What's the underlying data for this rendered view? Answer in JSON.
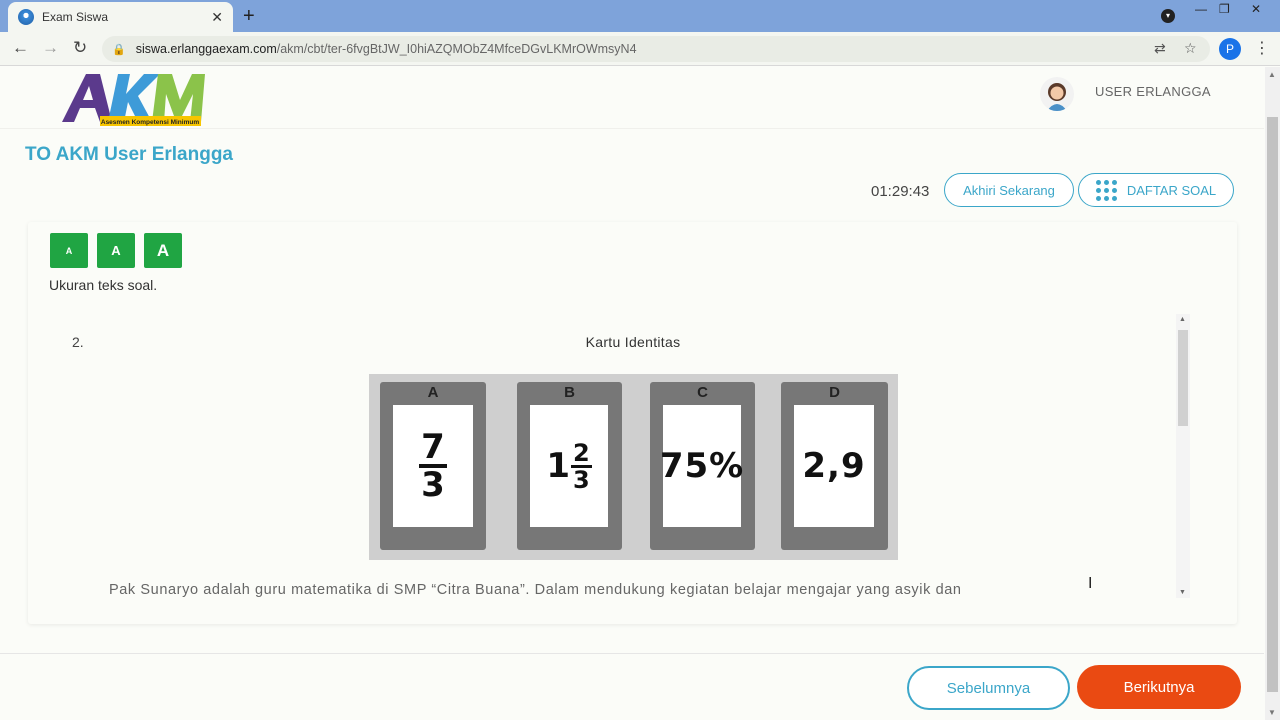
{
  "browser": {
    "tab_title": "Exam Siswa",
    "tab_close": "✕",
    "new_tab": "+",
    "url_host": "siswa.erlanggaexam.com",
    "url_path": "/akm/cbt/ter-6fvgBtJW_I0hiAZQMObZ4MfceDGvLKMrOWmsyN4",
    "profile_initial": "P",
    "window_controls": [
      "—",
      "❐",
      "✕"
    ]
  },
  "header": {
    "logo_text": "AKM",
    "logo_subtitle": "Asesmen Kompetensi Minimum",
    "username": "USER ERLANGGA",
    "exam_title": "TO AKM User Erlangga",
    "timer": "01:29:43",
    "end_button": "Akhiri Sekarang",
    "question_list_button": "DAFTAR SOAL"
  },
  "text_size": {
    "buttons": [
      "A",
      "A",
      "A"
    ],
    "label": "Ukuran teks soal."
  },
  "question": {
    "number": "2.",
    "title": "Kartu Identitas",
    "cards": [
      {
        "letter": "A",
        "value": "7/3",
        "numerator": "7",
        "denominator": "3"
      },
      {
        "letter": "B",
        "value": "1 2/3",
        "whole": "1",
        "numerator": "2",
        "denominator": "3"
      },
      {
        "letter": "C",
        "value": "75%"
      },
      {
        "letter": "D",
        "value": "2,9"
      }
    ],
    "text": "Pak Sunaryo adalah guru matematika di SMP “Citra Buana”. Dalam mendukung kegiatan belajar mengajar yang asyik dan"
  },
  "footer": {
    "prev_button": "Sebelumnya",
    "next_button": "Berikutnya"
  },
  "colors": {
    "accent": "#3ba6c9",
    "size_button": "#20a543",
    "next_button": "#ea4a12",
    "tab_bar": "#7ea3da"
  }
}
